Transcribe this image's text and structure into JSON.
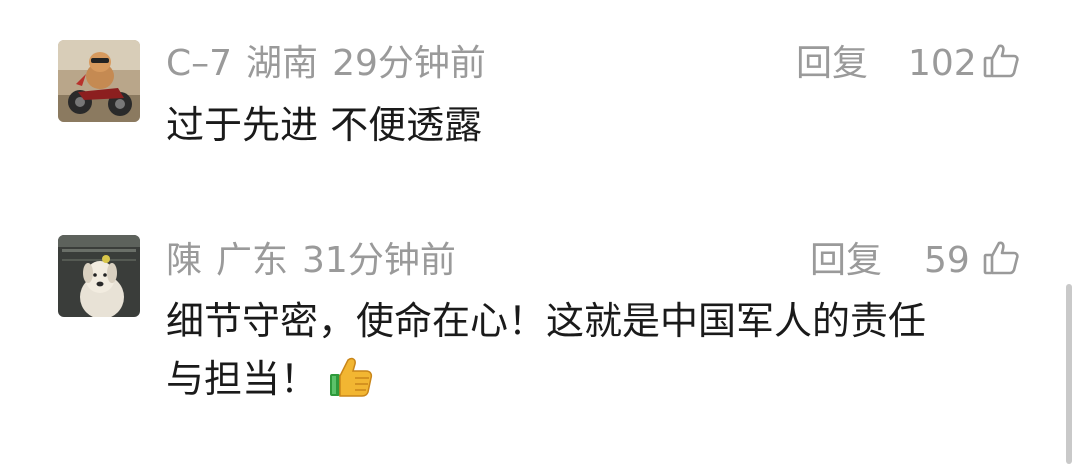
{
  "comments": [
    {
      "username": "C–7",
      "location": "湖南",
      "time": "29分钟前",
      "reply_label": "回复",
      "like_count": "102",
      "text": "过于先进 不便透露",
      "avatar_icon": "dog-on-motorcycle-avatar"
    },
    {
      "username": "陳",
      "location": "广东",
      "time": "31分钟前",
      "reply_label": "回复",
      "like_count": "59",
      "text_line1": "细节守密，使命在心！这就是中国军人的责任",
      "text_line2": "与担当！",
      "emoji": "thumbs-up",
      "avatar_icon": "white-dog-avatar"
    }
  ],
  "colors": {
    "meta_gray": "#9a9a9a",
    "text_dark": "#1a1a1a",
    "scrollbar": "#c9c9c9"
  }
}
